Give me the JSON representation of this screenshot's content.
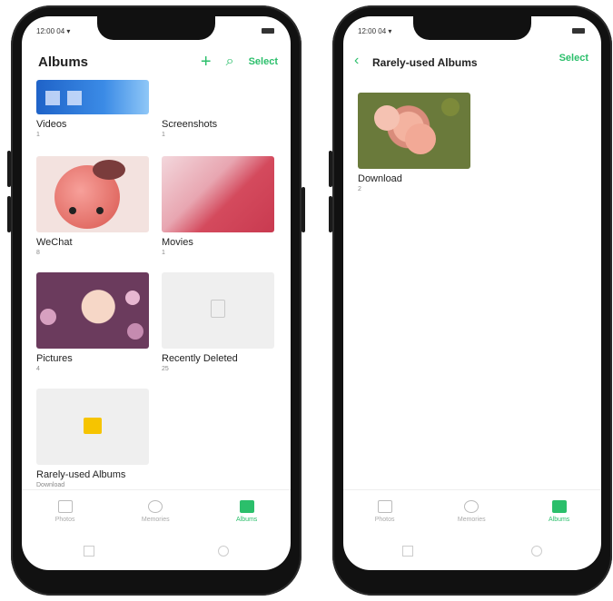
{
  "left_screen": {
    "status_time": "12:00 04 ▾",
    "title": "Albums",
    "select_label": "Select",
    "albums": [
      {
        "label": "Videos",
        "count": "1"
      },
      {
        "label": "Screenshots",
        "count": "1"
      },
      {
        "label": "WeChat",
        "count": "8"
      },
      {
        "label": "Movies",
        "count": "1"
      },
      {
        "label": "Pictures",
        "count": "4"
      },
      {
        "label": "Recently Deleted",
        "count": "25"
      },
      {
        "label": "Rarely-used Albums",
        "count": "Download"
      }
    ],
    "tabs": [
      "Photos",
      "Memories",
      "Albums"
    ]
  },
  "right_screen": {
    "status_time": "12:00 04 ▾",
    "title": "Rarely-used Albums",
    "select_label": "Select",
    "album": {
      "label": "Download",
      "count": "2"
    },
    "tabs": [
      "Photos",
      "Memories",
      "Albums"
    ]
  },
  "colors": {
    "accent": "#2bbf6b"
  }
}
